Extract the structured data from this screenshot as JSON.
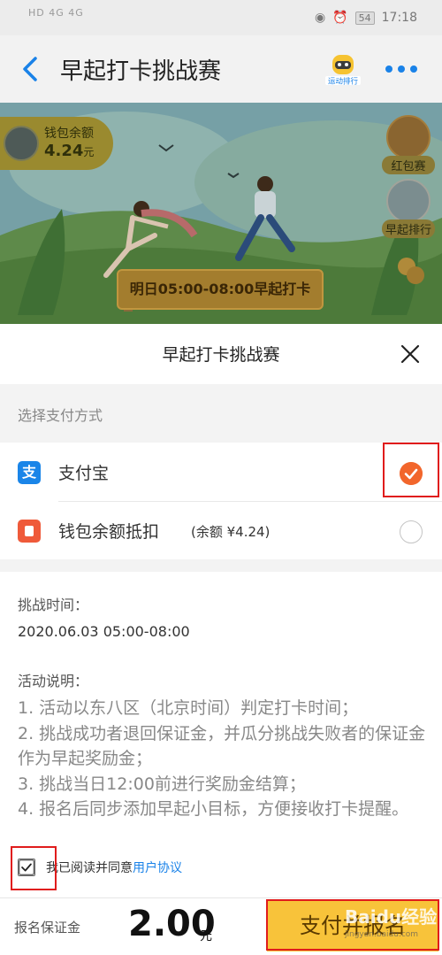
{
  "status_bar": {
    "network": "HD 4G 4G",
    "battery": "54",
    "time": "17:18"
  },
  "nav": {
    "title": "早起打卡挑战赛",
    "mascot_caption": "运动排行"
  },
  "banner": {
    "wallet_label": "钱包余额",
    "wallet_value": "4.24",
    "wallet_unit": "元",
    "red_packet_label": "红包赛",
    "early_rank_label": "早起排行",
    "checkin_text": "明日05:00-08:00早起打卡"
  },
  "sheet": {
    "title": "早起打卡挑战赛",
    "pay_method_label": "选择支付方式",
    "methods": [
      {
        "name": "支付宝",
        "selected": true
      },
      {
        "name": "钱包余额抵扣",
        "balance": "(余额 ¥4.24)",
        "selected": false
      }
    ]
  },
  "info": {
    "time_label": "挑战时间：",
    "time_value": "2020.06.03 05:00-08:00",
    "desc_label": "活动说明：",
    "rules": [
      "1. 活动以东八区（北京时间）判定打卡时间；",
      "2. 挑战成功者退回保证金，并瓜分挑战失败者的保证金作为早起奖励金；",
      "3. 挑战当日12:00前进行奖励金结算；",
      "4. 报名后同步添加早起小目标，方便接收打卡提醒。"
    ],
    "agree_text": "我已阅读并同意",
    "agree_link": "用户协议",
    "agree_checked": true
  },
  "bottom": {
    "deposit_label": "报名保证金",
    "amount": "2.00",
    "unit": "元",
    "pay_button": "支付并报名"
  },
  "watermark": {
    "text": "Baidu经验",
    "sub": "jingyan.baidu.com"
  },
  "colors": {
    "accent_blue": "#1a82e8",
    "selected_orange": "#f2662c",
    "pay_button": "#f8c33a",
    "highlight_red": "#e01c1c"
  }
}
